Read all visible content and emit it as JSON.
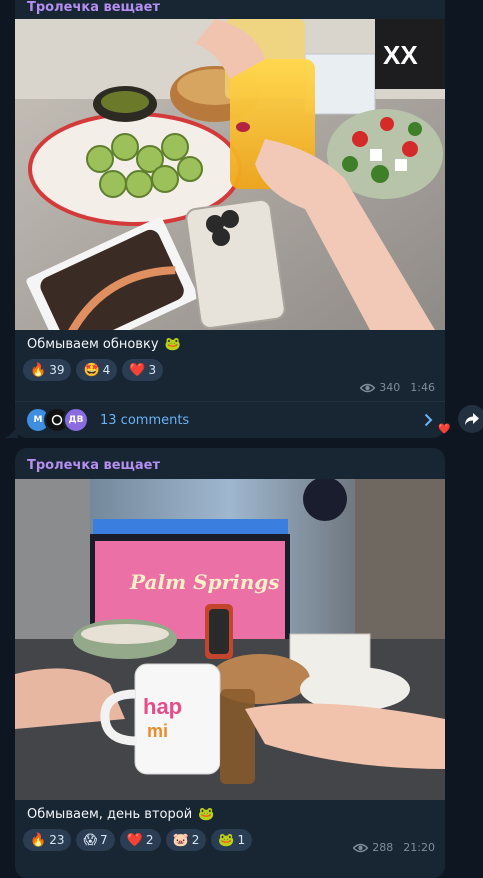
{
  "posts": [
    {
      "channel": "Тролечка вещает",
      "caption": "Обмываем обновку",
      "caption_emoji": "🐸",
      "reactions": [
        {
          "emoji": "🔥",
          "count": "39"
        },
        {
          "emoji": "🤩",
          "count": "4"
        },
        {
          "emoji": "❤️",
          "count": "3"
        }
      ],
      "views": "340",
      "time": "1:46",
      "comments_label": "13 comments",
      "commenter_avatars": [
        {
          "initials": "M",
          "color": "#3f8ee0"
        },
        {
          "initials": "",
          "color": "#111111"
        },
        {
          "initials": "ДВ",
          "color": "#8b6be0"
        }
      ]
    },
    {
      "channel": "Тролечка вещает",
      "caption": "Обмываем, день второй",
      "caption_emoji": "🐸",
      "reactions": [
        {
          "emoji": "🔥",
          "count": "23"
        },
        {
          "emoji": "😱",
          "count": "7"
        },
        {
          "emoji": "❤️",
          "count": "2"
        },
        {
          "emoji": "🐷",
          "count": "2"
        },
        {
          "emoji": "🐸",
          "count": "1"
        }
      ],
      "views": "288",
      "time": "21:20",
      "photo_text": "Palm Springs"
    }
  ],
  "share_reaction": "❤️",
  "colors": {
    "background": "#0e1621",
    "bubble": "#182533",
    "channel_name": "#b48ff0",
    "link": "#6ab3f3",
    "reaction_pill": "#2b3d52"
  }
}
